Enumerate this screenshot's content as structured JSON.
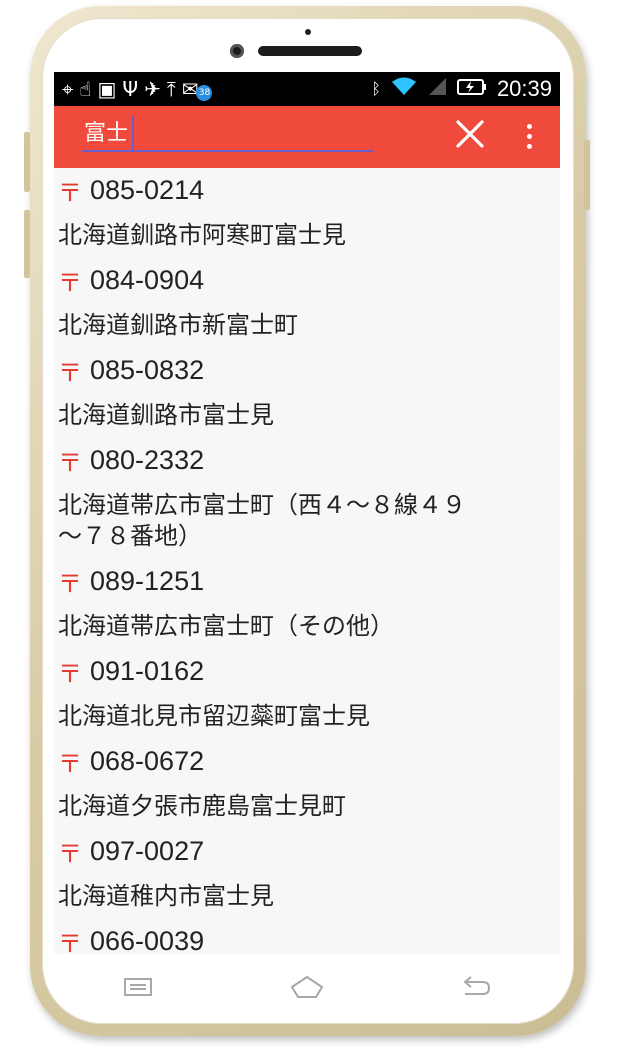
{
  "status_bar": {
    "time": "20:39",
    "notification_badge": "38",
    "left_icons": [
      "gps-icon",
      "hand-icon",
      "android-debug-icon",
      "usb-icon",
      "satellite-icon",
      "upload-icon",
      "mail-icon"
    ],
    "right_icons": [
      "bluetooth-icon",
      "wifi-icon",
      "signal-icon",
      "battery-charging-icon"
    ]
  },
  "toolbar": {
    "search_value": "富士",
    "accent_color": "#f04a3c"
  },
  "zip_mark": "〒",
  "results": [
    {
      "zip": "085-0214",
      "address": "北海道釧路市阿寒町富士見"
    },
    {
      "zip": "084-0904",
      "address": "北海道釧路市新富士町"
    },
    {
      "zip": "085-0832",
      "address": "北海道釧路市富士見"
    },
    {
      "zip": "080-2332",
      "address": "北海道帯広市富士町（西４～８線４９～７８番地）"
    },
    {
      "zip": "089-1251",
      "address": "北海道帯広市富士町（その他）"
    },
    {
      "zip": "091-0162",
      "address": "北海道北見市留辺蘂町富士見"
    },
    {
      "zip": "068-0672",
      "address": "北海道夕張市鹿島富士見町"
    },
    {
      "zip": "097-0027",
      "address": "北海道稚内市富士見"
    },
    {
      "zip": "066-0039",
      "address": ""
    }
  ],
  "nav": {
    "icons": [
      "recent-apps-icon",
      "home-icon",
      "back-icon"
    ]
  }
}
